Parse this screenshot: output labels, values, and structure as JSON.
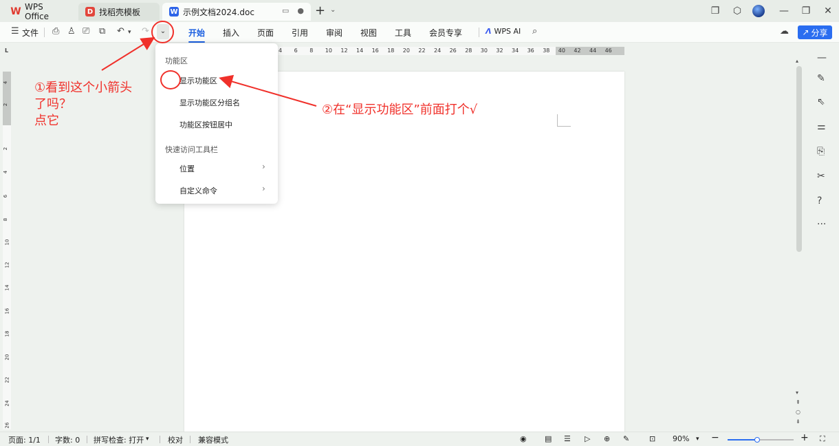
{
  "tabs": [
    {
      "label": "WPS Office",
      "logo": "W"
    },
    {
      "label": "找稻壳模板",
      "logo": "D"
    },
    {
      "label": "示例文档2024.doc",
      "logo": "W"
    }
  ],
  "menubar": {
    "file_label": "文件",
    "items": [
      "开始",
      "插入",
      "页面",
      "引用",
      "审阅",
      "视图",
      "工具",
      "会员专享"
    ],
    "wps_ai_label": "WPS AI",
    "share_label": "分享"
  },
  "dropdown": {
    "section1_header": "功能区",
    "items1": [
      "显示功能区",
      "显示功能区分组名",
      "功能区按钮居中"
    ],
    "section2_header": "快速访问工具栏",
    "items2": [
      "位置",
      "自定义命令"
    ]
  },
  "annotations": {
    "note1_line1": "①看到这个小箭头",
    "note1_line2": "了吗？",
    "note1_line3": "点它",
    "note2": "②在“显示功能区”前面打个√"
  },
  "ruler_h": [
    "4",
    "6",
    "8",
    "10",
    "12",
    "14",
    "16",
    "18",
    "20",
    "22",
    "24",
    "26",
    "28",
    "30",
    "32",
    "34",
    "36",
    "38",
    "40",
    "42",
    "44",
    "46"
  ],
  "ruler_v": [
    "4",
    "2",
    "2",
    "4",
    "6",
    "8",
    "10",
    "12",
    "14",
    "16",
    "18",
    "20",
    "22",
    "24",
    "26"
  ],
  "statusbar": {
    "page": "页面: 1/1",
    "words": "字数: 0",
    "spell": "拼写检查: 打开",
    "proof": "校对",
    "compat": "兼容模式",
    "zoom": "90%",
    "zoom_level_percent": 90
  },
  "colors": {
    "accent": "#1a5ee0",
    "annotation": "#f0302a",
    "share_button": "#2a6df0"
  }
}
